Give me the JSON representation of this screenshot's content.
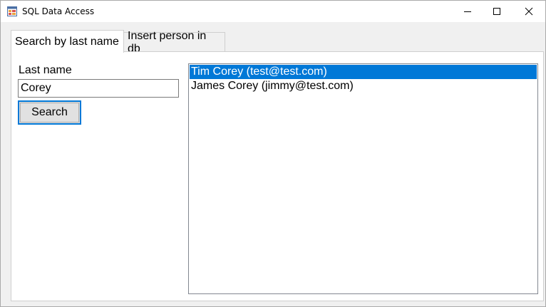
{
  "window": {
    "title": "SQL Data Access"
  },
  "tabs": [
    {
      "label": "Search by last name",
      "active": true
    },
    {
      "label": "Insert person in db",
      "active": false
    }
  ],
  "search": {
    "label": "Last name",
    "value": "Corey",
    "button_label": "Search"
  },
  "results": {
    "items": [
      {
        "text": "Tim Corey (test@test.com)",
        "selected": true
      },
      {
        "text": "James Corey (jimmy@test.com)",
        "selected": false
      }
    ]
  },
  "colors": {
    "selection": "#0078d7",
    "button_focus_border": "#0078d7",
    "window_bg": "#f0f0f0"
  }
}
